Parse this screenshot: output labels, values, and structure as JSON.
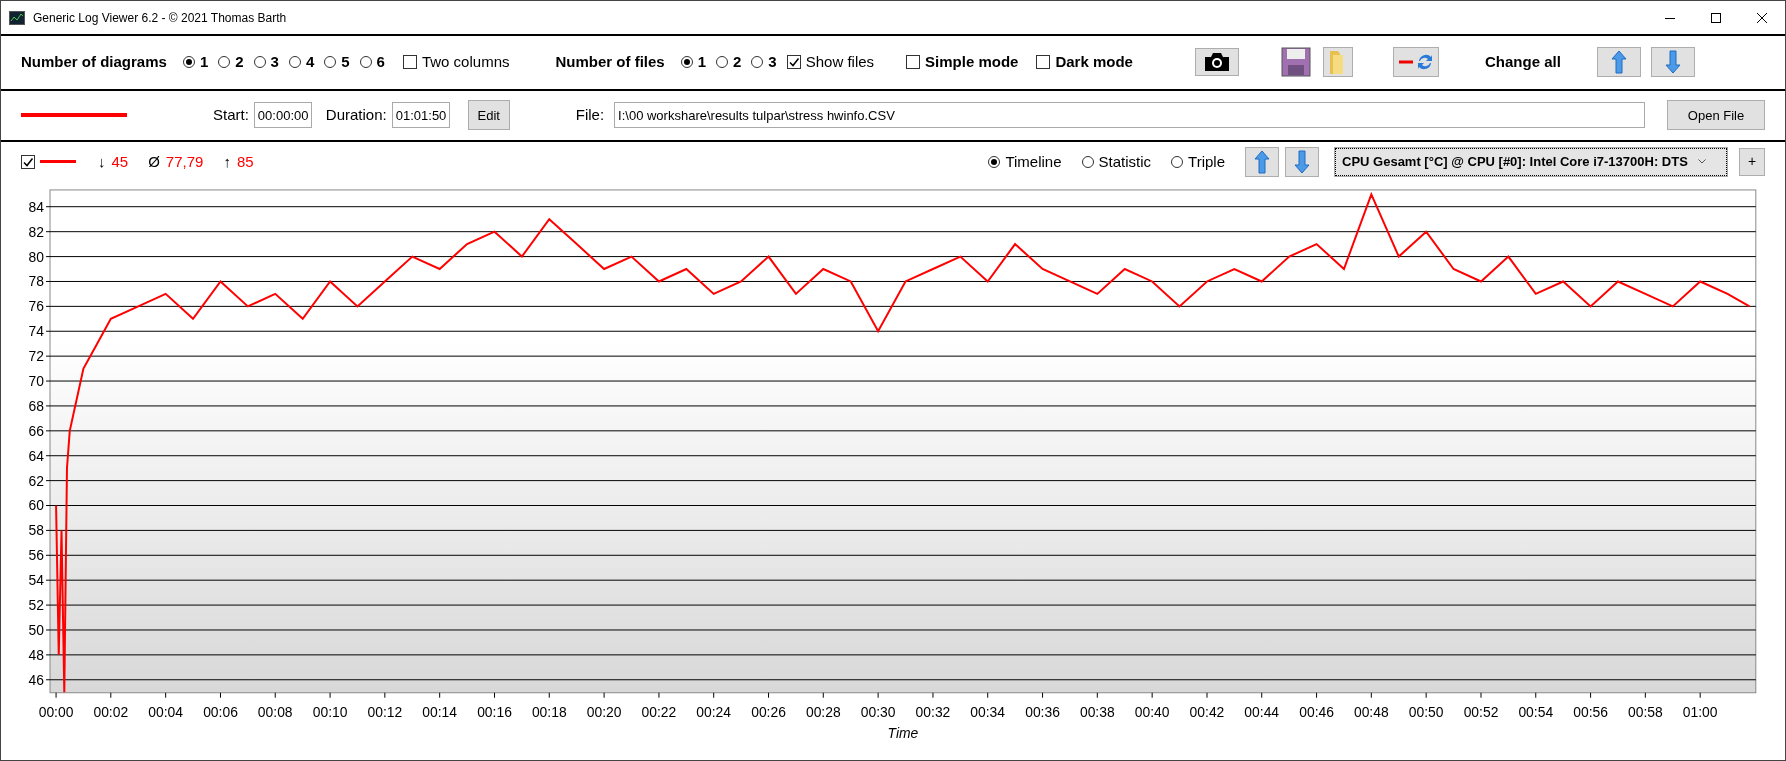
{
  "window": {
    "title": "Generic Log Viewer 6.2 - © 2021 Thomas Barth"
  },
  "toolbar": {
    "diagrams_label": "Number of diagrams",
    "diagram_options": [
      {
        "label": "1",
        "selected": true
      },
      {
        "label": "2",
        "selected": false
      },
      {
        "label": "3",
        "selected": false
      },
      {
        "label": "4",
        "selected": false
      },
      {
        "label": "5",
        "selected": false
      },
      {
        "label": "6",
        "selected": false
      }
    ],
    "two_columns": {
      "label": "Two columns",
      "checked": false
    },
    "files_label": "Number of files",
    "file_options": [
      {
        "label": "1",
        "selected": true
      },
      {
        "label": "2",
        "selected": false
      },
      {
        "label": "3",
        "selected": false
      }
    ],
    "show_files": {
      "label": "Show files",
      "checked": true
    },
    "simple_mode": {
      "label": "Simple mode",
      "checked": false
    },
    "dark_mode": {
      "label": "Dark mode",
      "checked": false
    },
    "change_all_label": "Change all"
  },
  "file_bar": {
    "start_label": "Start:",
    "start": "00:00:00",
    "duration_label": "Duration:",
    "duration": "01:01:50",
    "edit_button": "Edit",
    "file_label": "File:",
    "file_path": "I:\\00 workshare\\results tulpar\\stress hwinfo.CSV",
    "open_button": "Open File"
  },
  "diagram": {
    "visible": {
      "checked": true
    },
    "min_symbol": "↓",
    "min": "45",
    "avg_symbol": "Ø",
    "avg": "77,79",
    "max_symbol": "↑",
    "max": "85",
    "views": [
      {
        "label": "Timeline",
        "selected": true
      },
      {
        "label": "Statistic",
        "selected": false
      },
      {
        "label": "Triple",
        "selected": false
      }
    ],
    "channel": "CPU Gesamt [°C] @ CPU [#0]: Intel Core i7-13700H: DTS",
    "add_button": "+",
    "chart_data": {
      "type": "line",
      "xlabel": "Time",
      "x": [
        0,
        0.1,
        0.2,
        0.3,
        0.4,
        0.5,
        0.7,
        1,
        1.5,
        2,
        3,
        4,
        5,
        6,
        7,
        8,
        9,
        10,
        11,
        12,
        13,
        14,
        15,
        16,
        17,
        18,
        19,
        20,
        21,
        22,
        23,
        24,
        25,
        26,
        27,
        28,
        29,
        30,
        31,
        32,
        33,
        34,
        35,
        36,
        37,
        38,
        39,
        40,
        41,
        42,
        43,
        44,
        45,
        46,
        47,
        48,
        49,
        50,
        51,
        52,
        53,
        54,
        55,
        56,
        57,
        58,
        59,
        60,
        61,
        61.8
      ],
      "series": [
        {
          "color": "#ff0000",
          "values": [
            60,
            48,
            58,
            45,
            63,
            66,
            68,
            71,
            73,
            75,
            76,
            77,
            75,
            78,
            76,
            77,
            75,
            78,
            76,
            78,
            80,
            79,
            81,
            82,
            80,
            83,
            81,
            79,
            80,
            78,
            79,
            77,
            78,
            80,
            77,
            79,
            78,
            74,
            78,
            79,
            80,
            78,
            81,
            79,
            78,
            77,
            79,
            78,
            76,
            78,
            79,
            78,
            80,
            81,
            79,
            85,
            80,
            82,
            79,
            78,
            80,
            77,
            78,
            76,
            78,
            77,
            76,
            78,
            77,
            76
          ]
        }
      ],
      "grid": true,
      "xlim": [
        -0.22,
        62.03
      ],
      "ylim": [
        44.96,
        85.35
      ],
      "xticks": [
        {
          "value": 0,
          "label": "00:00"
        },
        {
          "value": 2,
          "label": "00:02"
        },
        {
          "value": 4,
          "label": "00:04"
        },
        {
          "value": 6,
          "label": "00:06"
        },
        {
          "value": 8,
          "label": "00:08"
        },
        {
          "value": 10,
          "label": "00:10"
        },
        {
          "value": 12,
          "label": "00:12"
        },
        {
          "value": 14,
          "label": "00:14"
        },
        {
          "value": 16,
          "label": "00:16"
        },
        {
          "value": 18,
          "label": "00:18"
        },
        {
          "value": 20,
          "label": "00:20"
        },
        {
          "value": 22,
          "label": "00:22"
        },
        {
          "value": 24,
          "label": "00:24"
        },
        {
          "value": 26,
          "label": "00:26"
        },
        {
          "value": 28,
          "label": "00:28"
        },
        {
          "value": 30,
          "label": "00:30"
        },
        {
          "value": 32,
          "label": "00:32"
        },
        {
          "value": 34,
          "label": "00:34"
        },
        {
          "value": 36,
          "label": "00:36"
        },
        {
          "value": 38,
          "label": "00:38"
        },
        {
          "value": 40,
          "label": "00:40"
        },
        {
          "value": 42,
          "label": "00:42"
        },
        {
          "value": 44,
          "label": "00:44"
        },
        {
          "value": 46,
          "label": "00:46"
        },
        {
          "value": 48,
          "label": "00:48"
        },
        {
          "value": 50,
          "label": "00:50"
        },
        {
          "value": 52,
          "label": "00:52"
        },
        {
          "value": 54,
          "label": "00:54"
        },
        {
          "value": 56,
          "label": "00:56"
        },
        {
          "value": 58,
          "label": "00:58"
        },
        {
          "value": 60,
          "label": "01:00"
        }
      ],
      "yticks": [
        46,
        48,
        50,
        52,
        54,
        56,
        58,
        60,
        62,
        64,
        66,
        68,
        70,
        72,
        74,
        76,
        78,
        80,
        82,
        84
      ]
    }
  }
}
